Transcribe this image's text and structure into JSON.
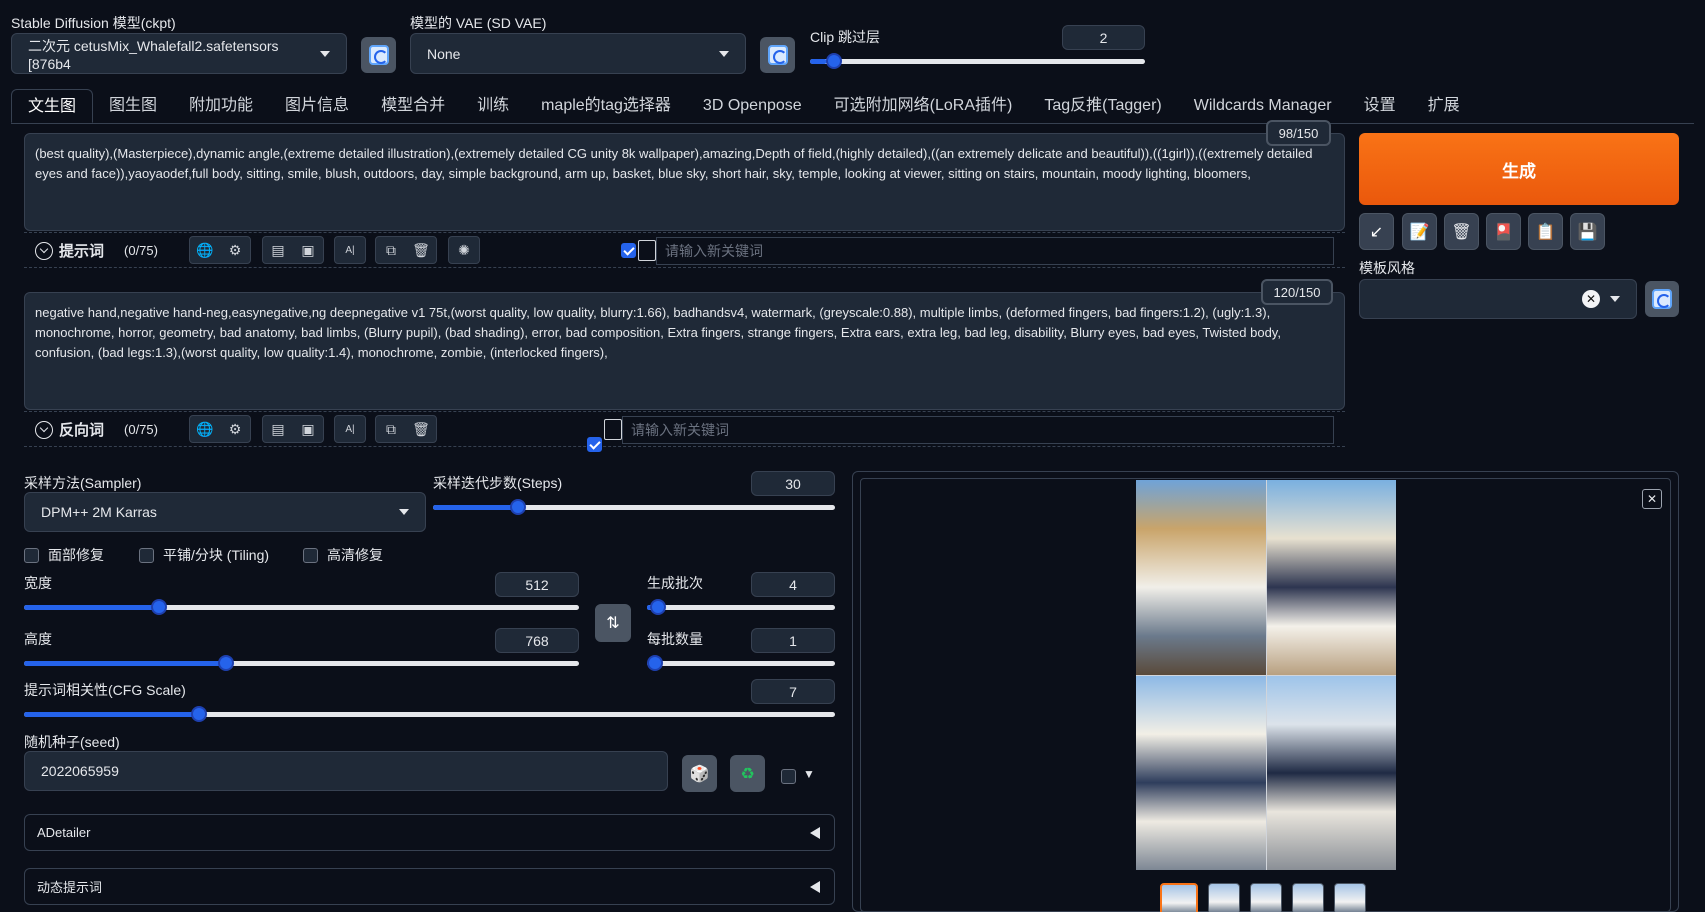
{
  "top": {
    "ckpt_label": "Stable Diffusion 模型(ckpt)",
    "ckpt_value": "二次元 cetusMix_Whalefall2.safetensors [876b4",
    "vae_label": "模型的 VAE (SD VAE)",
    "vae_value": "None",
    "clip_label": "Clip 跳过层",
    "clip_value": "2",
    "clip_fraction": 0.05
  },
  "tabs": [
    "文生图",
    "图生图",
    "附加功能",
    "图片信息",
    "模型合并",
    "训练",
    "maple的tag选择器",
    "3D Openpose",
    "可选附加网络(LoRA插件)",
    "Tag反推(Tagger)",
    "Wildcards Manager",
    "设置",
    "扩展"
  ],
  "prompt": {
    "text": "(best quality),(Masterpiece),dynamic angle,(extreme detailed illustration),(extremely detailed CG unity 8k wallpaper),amazing,Depth of field,(highly detailed),((an extremely delicate and beautiful)),((1girl)),((extremely detailed eyes and face)),yaoyaodef,full body, sitting, smile, blush, outdoors, day, simple background, arm up, basket, blue sky, short hair, sky, temple, looking at viewer, sitting on stairs, mountain, moody lighting, bloomers,",
    "counter": "98/150",
    "label": "提示词",
    "count": "(0/75)",
    "keyword_placeholder": "请输入新关键词"
  },
  "negative": {
    "text": "negative hand,negative hand-neg,easynegative,ng deepnegative v1 75t,(worst quality, low quality, blurry:1.66), badhandsv4, watermark, (greyscale:0.88), multiple limbs, (deformed fingers, bad fingers:1.2), (ugly:1.3), monochrome, horror, geometry, bad anatomy, bad limbs, (Blurry pupil), (bad shading), error, bad composition, Extra fingers, strange fingers, Extra ears, extra leg, bad leg, disability, Blurry eyes, bad eyes, Twisted body, confusion, (bad legs:1.3),(worst quality, low quality:1.4), monochrome, zombie, (interlocked fingers),",
    "counter": "120/150",
    "label": "反向词",
    "count": "(0/75)",
    "keyword_placeholder": "请输入新关键词"
  },
  "right": {
    "generate": "生成",
    "style_label": "模板风格"
  },
  "sampler": {
    "label": "采样方法(Sampler)",
    "value": "DPM++ 2M Karras",
    "steps_label": "采样迭代步数(Steps)",
    "steps_value": "30",
    "steps_fraction": 0.2
  },
  "options": {
    "face_restore": "面部修复",
    "tiling": "平铺/分块 (Tiling)",
    "hires": "高清修复"
  },
  "size": {
    "width_label": "宽度",
    "width_value": "512",
    "width_fraction": 0.235,
    "height_label": "高度",
    "height_value": "768",
    "height_fraction": 0.36,
    "batch_count_label": "生成批次",
    "batch_count_value": "4",
    "batch_count_fraction": 0.02,
    "batch_size_label": "每批数量",
    "batch_size_value": "1",
    "batch_size_fraction": 0.0
  },
  "cfg": {
    "label": "提示词相关性(CFG Scale)",
    "value": "7",
    "fraction": 0.21
  },
  "seed": {
    "label": "随机种子(seed)",
    "value": "2022065959"
  },
  "accordions": {
    "adetailer": "ADetailer",
    "dynamic_prompts": "动态提示词"
  },
  "colors": {
    "accent": "#2563eb",
    "generate": "#f97316",
    "background": "#0b0f19"
  }
}
